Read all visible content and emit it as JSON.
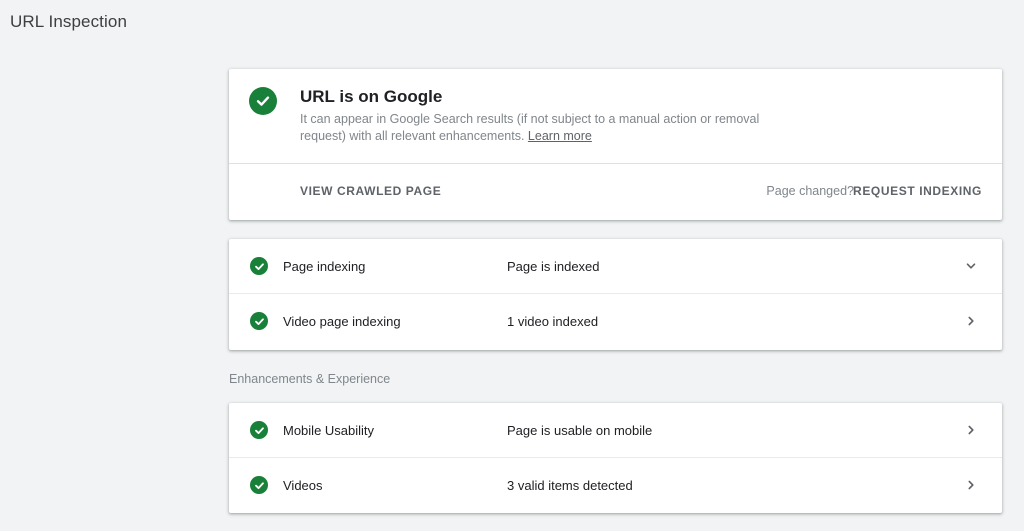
{
  "page": {
    "title": "URL Inspection"
  },
  "status": {
    "title": "URL is on Google",
    "description": "It can appear in Google Search results (if not subject to a manual action or removal request) with all relevant enhancements.",
    "learn_more": "Learn more",
    "view_crawled_label": "VIEW CRAWLED PAGE",
    "page_changed_label": "Page changed?",
    "request_indexing_label": "REQUEST INDEXING",
    "icon": "check-circle-icon",
    "color": "#188038"
  },
  "indexing": {
    "rows": [
      {
        "label": "Page indexing",
        "value": "Page is indexed",
        "chevron": "chevron-down-icon"
      },
      {
        "label": "Video page indexing",
        "value": "1 video indexed",
        "chevron": "chevron-right-icon"
      }
    ]
  },
  "enhancements": {
    "section_label": "Enhancements & Experience",
    "rows": [
      {
        "label": "Mobile Usability",
        "value": "Page is usable on mobile",
        "chevron": "chevron-right-icon"
      },
      {
        "label": "Videos",
        "value": "3 valid items detected",
        "chevron": "chevron-right-icon"
      }
    ]
  }
}
